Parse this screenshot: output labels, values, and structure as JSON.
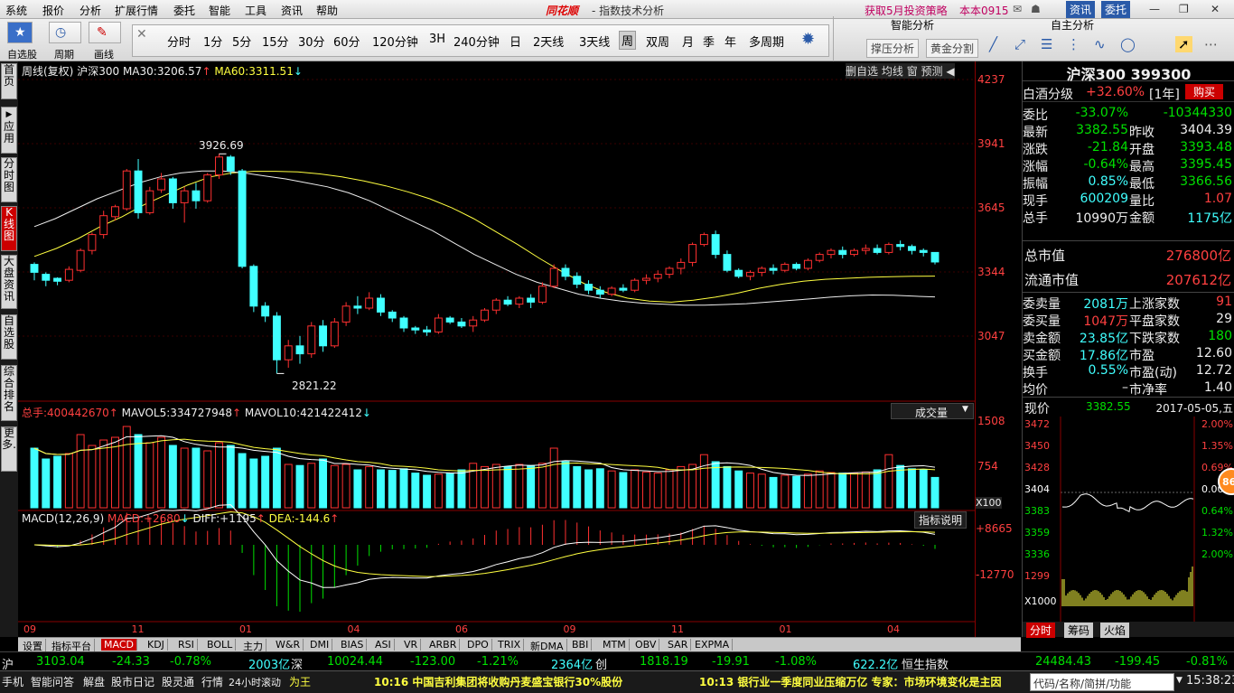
{
  "menu": {
    "items": [
      "系统",
      "报价",
      "分析",
      "扩展行情",
      "委托",
      "智能",
      "工具",
      "资讯",
      "帮助"
    ],
    "brand": "同花顺",
    "window_title": "- 指数技术分析",
    "promo": "获取5月投资策略",
    "version": "本本0915",
    "btn_info": "资讯",
    "btn_trade": "委托"
  },
  "toolbar": {
    "quick": [
      "自选股",
      "周期",
      "画线"
    ],
    "periods": [
      "分时",
      "1分",
      "5分",
      "15分",
      "30分",
      "60分",
      "120分钟",
      "3H",
      "240分钟",
      "日",
      "2天线",
      "3天线",
      "周",
      "双周",
      "月",
      "季",
      "年",
      "多周期"
    ],
    "selected_period": "周",
    "smart_title": "智能分析",
    "self_title": "自主分析",
    "smart_btns": [
      "撑压分析",
      "黄金分割"
    ]
  },
  "left_tabs": [
    "首页",
    "应用",
    "分时图",
    "K线图",
    "大盘资讯",
    "自选股",
    "综合排名",
    "更多."
  ],
  "kline": {
    "header_label": "周线(复权)",
    "code_name": "沪深300",
    "ma30_label": "MA30:",
    "ma30_value": "3206.57",
    "ma60_label": "MA60:",
    "ma60_value": "3311.51",
    "high_label": "3926.69",
    "low_label": "2821.22",
    "y_ticks": [
      "4237",
      "3941",
      "3645",
      "3344",
      "3047"
    ],
    "ctrl_btns": [
      "删自选",
      "均线",
      "窗",
      "预测"
    ]
  },
  "volume": {
    "total_label": "总手:",
    "total_value": "400442670",
    "mavol5_label": "MAVOL5:",
    "mavol5_value": "334727948",
    "mavol10_label": "MAVOL10:",
    "mavol10_value": "421422412",
    "dropdown": "成交量",
    "y_ticks": [
      "1508",
      "754"
    ],
    "unit": "X100"
  },
  "macd": {
    "label": "MACD(12,26,9)",
    "macd_label": "MACD:",
    "macd_value": "+2680",
    "diff_label": "DIFF:",
    "diff_value": "+1195",
    "dea_label": "DEA:",
    "dea_value": "-144.6",
    "explain_btn": "指标说明",
    "y_ticks": [
      "+8665",
      "-12770"
    ]
  },
  "x_axis": [
    "09",
    "11",
    "01",
    "04",
    "06",
    "09",
    "11",
    "01",
    "04"
  ],
  "indicator_tabs": [
    "设置",
    "指标平台",
    "MACD",
    "KDJ",
    "RSI",
    "BOLL",
    "主力",
    "W&R",
    "DMI",
    "BIAS",
    "ASI",
    "VR",
    "ARBR",
    "DPO",
    "TRIX",
    "新DMA",
    "BBI",
    "MTM",
    "OBV",
    "SAR",
    "EXPMA"
  ],
  "selected_indicator": "MACD",
  "quote": {
    "title": "沪深300 399300",
    "sector_name": "白酒分级",
    "sector_change": "+32.60%",
    "sector_period": "[1年]",
    "buy_btn": "购买",
    "rows": [
      {
        "l1": "委比",
        "v1": "-33.07%",
        "c1": "green",
        "l2": "",
        "v2": "-10344330",
        "c2": "green"
      },
      {
        "l1": "最新",
        "v1": "3382.55",
        "c1": "green",
        "l2": "昨收",
        "v2": "3404.39",
        "c2": "white"
      },
      {
        "l1": "涨跌",
        "v1": "-21.84",
        "c1": "green",
        "l2": "开盘",
        "v2": "3393.48",
        "c2": "green"
      },
      {
        "l1": "涨幅",
        "v1": "-0.64%",
        "c1": "green",
        "l2": "最高",
        "v2": "3395.45",
        "c2": "green"
      },
      {
        "l1": "振幅",
        "v1": "0.85%",
        "c1": "cyan",
        "l2": "最低",
        "v2": "3366.56",
        "c2": "green"
      },
      {
        "l1": "现手",
        "v1": "600209",
        "c1": "cyan",
        "l2": "量比",
        "v2": "1.07",
        "c2": "red"
      },
      {
        "l1": "总手",
        "v1": "10990万",
        "c1": "white",
        "l2": "金额",
        "v2": "1175亿",
        "c2": "cyan"
      }
    ],
    "mkt_cap_label": "总市值",
    "mkt_cap": "276800亿",
    "float_cap_label": "流通市值",
    "float_cap": "207612亿",
    "rows2": [
      {
        "l1": "委卖量",
        "v1": "2081万",
        "c1": "cyan",
        "l2": "上涨家数",
        "v2": "91",
        "c2": "red"
      },
      {
        "l1": "委买量",
        "v1": "1047万",
        "c1": "red",
        "l2": "平盘家数",
        "v2": "29",
        "c2": "white"
      },
      {
        "l1": "卖金额",
        "v1": "23.85亿",
        "c1": "cyan",
        "l2": "下跌家数",
        "v2": "180",
        "c2": "green"
      },
      {
        "l1": "买金额",
        "v1": "17.86亿",
        "c1": "cyan",
        "l2": "市盈",
        "v2": "12.60",
        "c2": "white"
      },
      {
        "l1": "换手",
        "v1": "0.55%",
        "c1": "cyan",
        "l2": "市盈(动)",
        "v2": "12.72",
        "c2": "white"
      },
      {
        "l1": "均价",
        "v1": "–",
        "c1": "white",
        "l2": "市净率",
        "v2": "1.40",
        "c2": "white"
      }
    ]
  },
  "mini": {
    "now_label": "现价",
    "now_value": "3382.55",
    "date": "2017-05-05,五",
    "price_ticks": [
      "3472",
      "3450",
      "3428",
      "3404",
      "3383",
      "3359",
      "3336",
      "1299"
    ],
    "pct_ticks": [
      "2.00%",
      "1.35%",
      "0.69%",
      "0.00%",
      "0.64%",
      "1.32%",
      "2.00%"
    ],
    "unit": "X1000",
    "tabs": [
      "分时",
      "筹码",
      "火焰"
    ],
    "badge": "86"
  },
  "ticker": {
    "sh_mark": "沪",
    "sh_index": "3103.04",
    "sh_chg": "-24.33",
    "sh_pct": "-0.78%",
    "sh_amt": "2003亿",
    "sz_mark": "深",
    "sz_index": "10024.44",
    "sz_chg": "-123.00",
    "sz_pct": "-1.21%",
    "sz_amt": "2364亿",
    "cy_mark": "创",
    "cy_index": "1818.19",
    "cy_chg": "-19.91",
    "cy_pct": "-1.08%",
    "cy_amt": "622.2亿",
    "hs_name": "恒生指数",
    "hs_index": "24484.43",
    "hs_chg": "-199.45",
    "hs_pct": "-0.81%"
  },
  "status": {
    "items": [
      "手机",
      "智能问答",
      "解盘",
      "股市日记",
      "股灵通",
      "行情",
      "24小时滚动"
    ],
    "king": "为王",
    "news1": "10:16 中国吉利集团将收购丹麦盛宝银行30%股份",
    "news2": "10:13 银行业一季度同业压缩万亿 专家：市场环境变化是主因",
    "search": "代码/名称/简拼/功能",
    "time": "15:38:23"
  },
  "chart_data": {
    "type": "candlestick",
    "period": "weekly",
    "ylim": [
      2700,
      4300
    ],
    "candles": [
      [
        3370,
        3380,
        3290,
        3330
      ],
      [
        3320,
        3330,
        3260,
        3290
      ],
      [
        3300,
        3305,
        3265,
        3285
      ],
      [
        3290,
        3360,
        3280,
        3345
      ],
      [
        3340,
        3450,
        3330,
        3440
      ],
      [
        3440,
        3530,
        3420,
        3520
      ],
      [
        3520,
        3640,
        3500,
        3615
      ],
      [
        3610,
        3670,
        3590,
        3660
      ],
      [
        3650,
        3850,
        3640,
        3840
      ],
      [
        3840,
        3900,
        3600,
        3630
      ],
      [
        3630,
        3760,
        3620,
        3740
      ],
      [
        3745,
        3830,
        3730,
        3800
      ],
      [
        3800,
        3810,
        3650,
        3680
      ],
      [
        3680,
        3760,
        3580,
        3740
      ],
      [
        3740,
        3780,
        3650,
        3690
      ],
      [
        3690,
        3830,
        3680,
        3820
      ],
      [
        3820,
        3926,
        3800,
        3910
      ],
      [
        3910,
        3920,
        3820,
        3840
      ],
      [
        3840,
        3850,
        3350,
        3360
      ],
      [
        3360,
        3370,
        3130,
        3160
      ],
      [
        3160,
        3180,
        3080,
        3110
      ],
      [
        3110,
        3130,
        2821,
        2890
      ],
      [
        2890,
        2990,
        2850,
        2960
      ],
      [
        2960,
        3010,
        2870,
        2920
      ],
      [
        2920,
        3080,
        2900,
        3060
      ],
      [
        3060,
        3090,
        2930,
        2960
      ],
      [
        2960,
        3100,
        2950,
        3080
      ],
      [
        3080,
        3180,
        3060,
        3160
      ],
      [
        3160,
        3210,
        3120,
        3150
      ],
      [
        3150,
        3230,
        3140,
        3200
      ],
      [
        3200,
        3220,
        3110,
        3130
      ],
      [
        3130,
        3140,
        3080,
        3100
      ],
      [
        3100,
        3110,
        3030,
        3050
      ],
      [
        3050,
        3060,
        3020,
        3040
      ],
      [
        3040,
        3060,
        3010,
        3030
      ],
      [
        3030,
        3120,
        3020,
        3100
      ],
      [
        3100,
        3110,
        3070,
        3080
      ],
      [
        3080,
        3100,
        3050,
        3060
      ],
      [
        3060,
        3110,
        3030,
        3090
      ],
      [
        3090,
        3150,
        3080,
        3140
      ],
      [
        3140,
        3200,
        3120,
        3190
      ],
      [
        3190,
        3210,
        3160,
        3170
      ],
      [
        3170,
        3210,
        3150,
        3200
      ],
      [
        3200,
        3220,
        3150,
        3180
      ],
      [
        3180,
        3280,
        3170,
        3260
      ],
      [
        3260,
        3370,
        3250,
        3350
      ],
      [
        3350,
        3370,
        3290,
        3310
      ],
      [
        3310,
        3330,
        3250,
        3270
      ],
      [
        3270,
        3290,
        3220,
        3240
      ],
      [
        3240,
        3260,
        3200,
        3220
      ],
      [
        3220,
        3260,
        3210,
        3250
      ],
      [
        3250,
        3270,
        3230,
        3240
      ],
      [
        3240,
        3300,
        3230,
        3290
      ],
      [
        3290,
        3320,
        3270,
        3300
      ],
      [
        3300,
        3340,
        3280,
        3320
      ],
      [
        3320,
        3360,
        3300,
        3350
      ],
      [
        3350,
        3400,
        3320,
        3380
      ],
      [
        3380,
        3480,
        3360,
        3470
      ],
      [
        3470,
        3530,
        3460,
        3520
      ],
      [
        3520,
        3540,
        3400,
        3420
      ],
      [
        3420,
        3440,
        3330,
        3340
      ],
      [
        3340,
        3350,
        3300,
        3310
      ],
      [
        3310,
        3340,
        3290,
        3330
      ],
      [
        3330,
        3360,
        3310,
        3350
      ],
      [
        3350,
        3370,
        3320,
        3340
      ],
      [
        3340,
        3380,
        3330,
        3370
      ],
      [
        3370,
        3380,
        3340,
        3350
      ],
      [
        3350,
        3400,
        3340,
        3390
      ],
      [
        3390,
        3430,
        3380,
        3420
      ],
      [
        3420,
        3450,
        3400,
        3440
      ],
      [
        3440,
        3460,
        3400,
        3420
      ],
      [
        3420,
        3450,
        3410,
        3440
      ],
      [
        3440,
        3470,
        3420,
        3450
      ],
      [
        3450,
        3470,
        3420,
        3430
      ],
      [
        3430,
        3480,
        3420,
        3470
      ],
      [
        3470,
        3490,
        3440,
        3460
      ],
      [
        3460,
        3470,
        3420,
        3440
      ],
      [
        3440,
        3450,
        3410,
        3430
      ],
      [
        3430,
        3430,
        3370,
        3382
      ]
    ],
    "volumes": [
      1100,
      900,
      950,
      1000,
      1350,
      1150,
      1250,
      1300,
      1500,
      1350,
      1200,
      1300,
      1150,
      1100,
      1100,
      1050,
      1200,
      1150,
      1000,
      900,
      950,
      1100,
      800,
      780,
      820,
      900,
      780,
      800,
      700,
      760,
      700,
      690,
      720,
      640,
      600,
      620,
      640,
      700,
      820,
      760,
      800,
      760,
      800,
      780,
      820,
      1100,
      850,
      760,
      700,
      720,
      680,
      650,
      700,
      660,
      640,
      700,
      760,
      800,
      980,
      850,
      760,
      680,
      640,
      620,
      560,
      600,
      580,
      620,
      680,
      650,
      640,
      640,
      660,
      700,
      980,
      780,
      720,
      700,
      560
    ],
    "ma30": [
      3560,
      3600,
      3650,
      3700,
      3740,
      3780,
      3810,
      3830,
      3840,
      3840,
      3830,
      3815,
      3800,
      3780,
      3760,
      3730,
      3690,
      3640,
      3590,
      3540,
      3480,
      3420,
      3370,
      3320,
      3280,
      3250,
      3220,
      3200,
      3185,
      3175,
      3170,
      3165,
      3165,
      3168,
      3172,
      3180,
      3188,
      3196,
      3205,
      3212,
      3216,
      3215,
      3210,
      3206
    ],
    "ma60": [
      3410,
      3450,
      3500,
      3560,
      3610,
      3670,
      3720,
      3770,
      3810,
      3830,
      3838,
      3838,
      3835,
      3825,
      3810,
      3790,
      3765,
      3735,
      3700,
      3655,
      3600,
      3535,
      3470,
      3400,
      3335,
      3275,
      3230,
      3200,
      3185,
      3180,
      3190,
      3205,
      3225,
      3250,
      3270,
      3285,
      3295,
      3300,
      3305,
      3308,
      3310,
      3311
    ]
  }
}
